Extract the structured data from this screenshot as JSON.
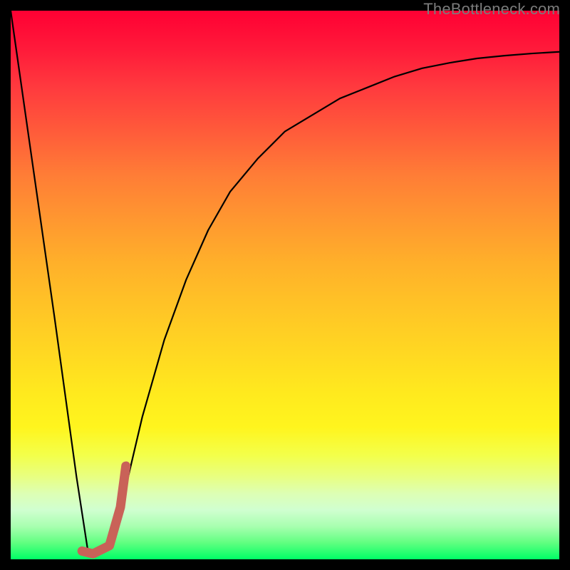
{
  "watermark": "TheBottleneck.com",
  "chart_data": {
    "type": "line",
    "title": "",
    "xlabel": "",
    "ylabel": "",
    "xlim": [
      0,
      1
    ],
    "ylim": [
      0,
      1
    ],
    "background_gradient": {
      "direction": "vertical",
      "stops": [
        {
          "pos": 0.0,
          "color": "#ff0033"
        },
        {
          "pos": 0.5,
          "color": "#ffb300"
        },
        {
          "pos": 0.8,
          "color": "#ffff33"
        },
        {
          "pos": 1.0,
          "color": "#00ff66"
        }
      ]
    },
    "series": [
      {
        "name": "curve",
        "stroke": "#000000",
        "x": [
          0.0,
          0.04,
          0.08,
          0.12,
          0.14,
          0.16,
          0.18,
          0.2,
          0.24,
          0.28,
          0.32,
          0.36,
          0.4,
          0.45,
          0.5,
          0.55,
          0.6,
          0.65,
          0.7,
          0.75,
          0.8,
          0.85,
          0.9,
          0.95,
          1.0
        ],
        "y": [
          1.0,
          0.72,
          0.44,
          0.15,
          0.02,
          0.01,
          0.03,
          0.09,
          0.26,
          0.4,
          0.51,
          0.6,
          0.67,
          0.73,
          0.78,
          0.81,
          0.84,
          0.86,
          0.88,
          0.895,
          0.905,
          0.913,
          0.918,
          0.922,
          0.925
        ]
      },
      {
        "name": "highlight-range",
        "stroke": "#c96258",
        "x": [
          0.13,
          0.15,
          0.18,
          0.2,
          0.21
        ],
        "y": [
          0.015,
          0.01,
          0.025,
          0.095,
          0.17
        ]
      }
    ]
  }
}
